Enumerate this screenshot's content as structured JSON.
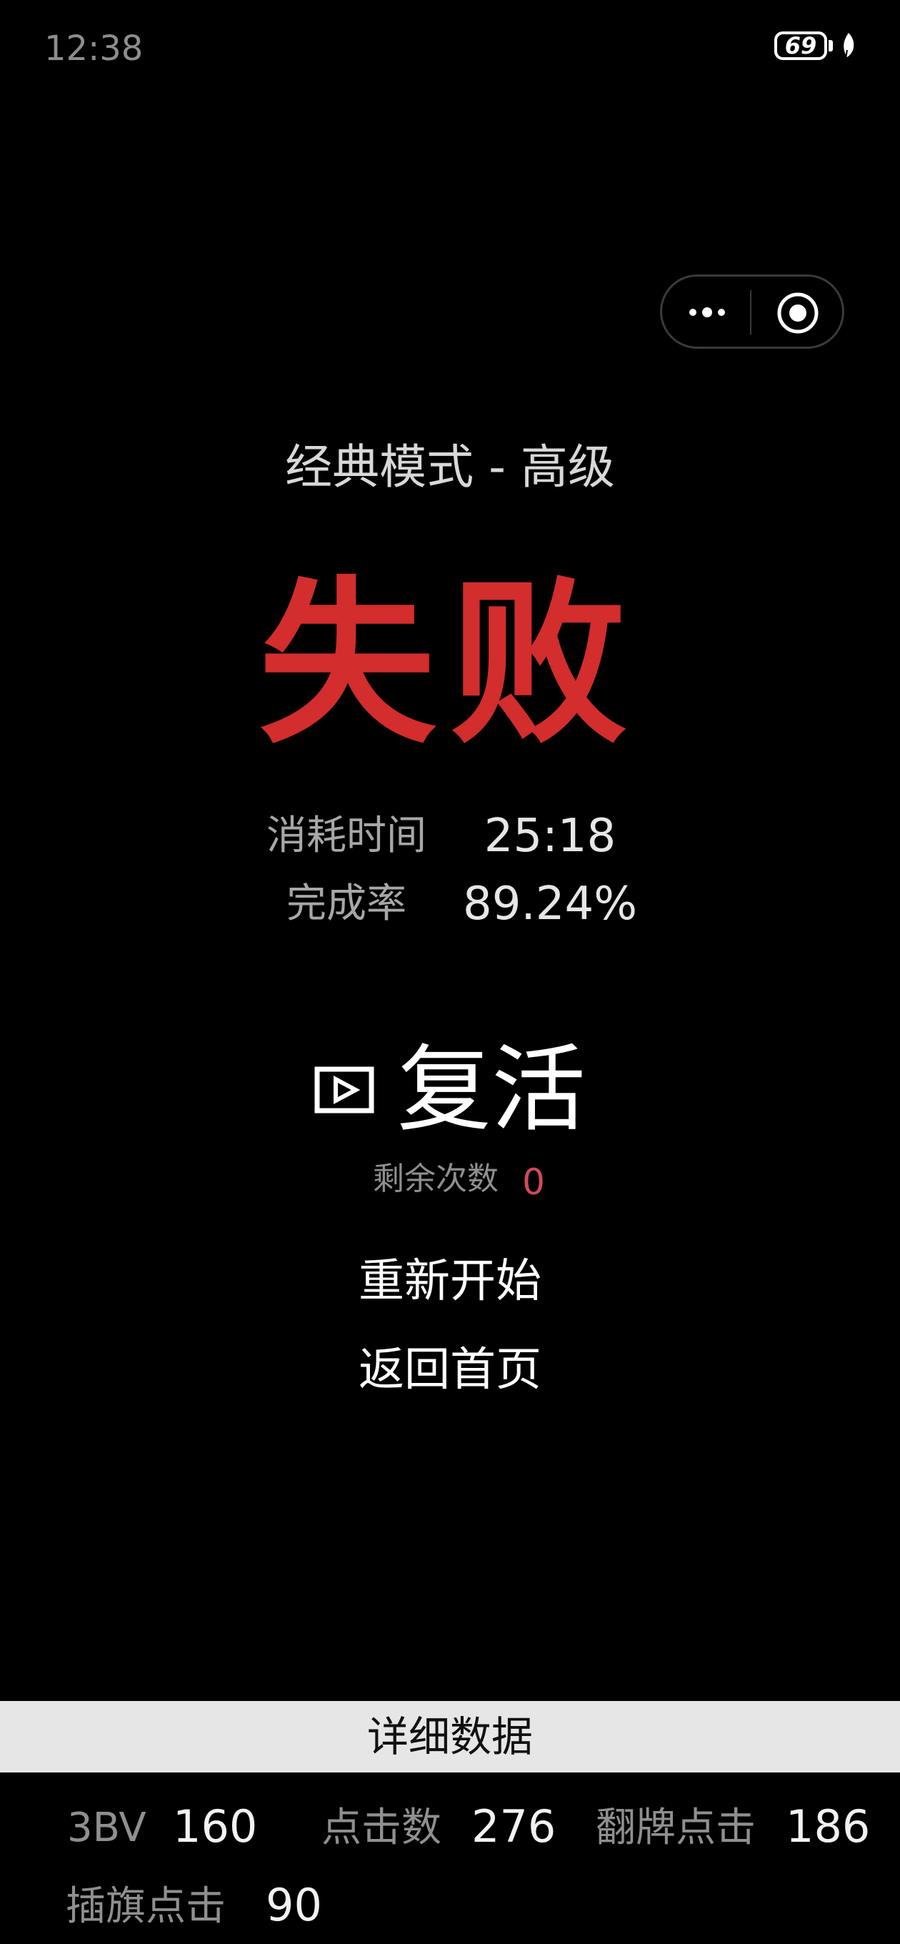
{
  "status_bar": {
    "time": "12:38",
    "battery": "69",
    "icons": [
      "battery-icon",
      "leaf-icon"
    ]
  },
  "capsule": {
    "icons": [
      "more-icon",
      "target-icon"
    ]
  },
  "game": {
    "mode_title": "经典模式 - 高级",
    "result": "失败",
    "time_label": "消耗时间",
    "time_value": "25:18",
    "completion_label": "完成率",
    "completion_value": "89.24%"
  },
  "actions": {
    "revive_label": "复活",
    "revive_icon": "video-play-icon",
    "remaining_label": "剩余次数",
    "remaining_value": "0",
    "restart_label": "重新开始",
    "home_label": "返回首页"
  },
  "details": {
    "header": "详细数据",
    "bv_label": "3BV",
    "bv_value": "160",
    "clicks_label": "点击数",
    "clicks_value": "276",
    "reveal_label": "翻牌点击",
    "reveal_value": "186",
    "flag_label": "插旗点击",
    "flag_value": "90"
  },
  "colors": {
    "background": "#000000",
    "fail_red": "#d32d2d",
    "remaining_red": "#cf4a5b",
    "detail_bar": "#e6e6e6"
  }
}
